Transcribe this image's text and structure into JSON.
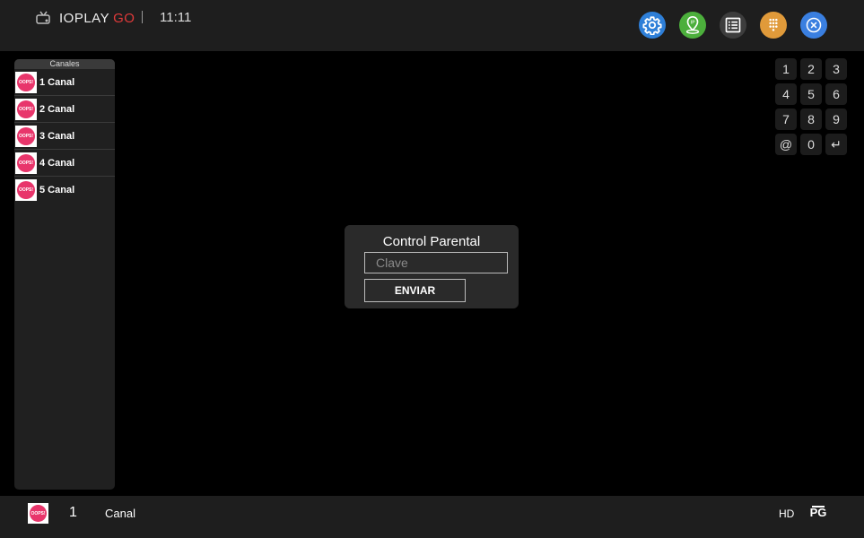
{
  "app": {
    "brand": "IOPLAY",
    "brand_suffix": "GO",
    "clock": "11:11"
  },
  "header_icons": [
    {
      "icon": "gear-icon",
      "color": "#2e7fd8"
    },
    {
      "icon": "ip-location-icon",
      "color": "#4caf3c"
    },
    {
      "icon": "list-icon",
      "color": "#3d3d3d"
    },
    {
      "icon": "dialpad-icon",
      "color": "#e09a3a"
    },
    {
      "icon": "close-icon",
      "color": "#3a7fe0"
    }
  ],
  "sidebar": {
    "title": "Canales",
    "logo_text": "OOPS!",
    "channels": [
      {
        "label": "1 Canal"
      },
      {
        "label": "2 Canal"
      },
      {
        "label": "3 Canal"
      },
      {
        "label": "4 Canal"
      },
      {
        "label": "5 Canal"
      }
    ]
  },
  "keypad": {
    "keys": [
      "1",
      "2",
      "3",
      "4",
      "5",
      "6",
      "7",
      "8",
      "9",
      "@",
      "0",
      "↵"
    ]
  },
  "dialog": {
    "title": "Control Parental",
    "password_placeholder": "Clave",
    "submit_label": "ENVIAR"
  },
  "bottom_bar": {
    "logo_text": "OOPS!",
    "channel_number": "1",
    "channel_name": "Canal",
    "quality": "HD",
    "rating": "PG"
  }
}
